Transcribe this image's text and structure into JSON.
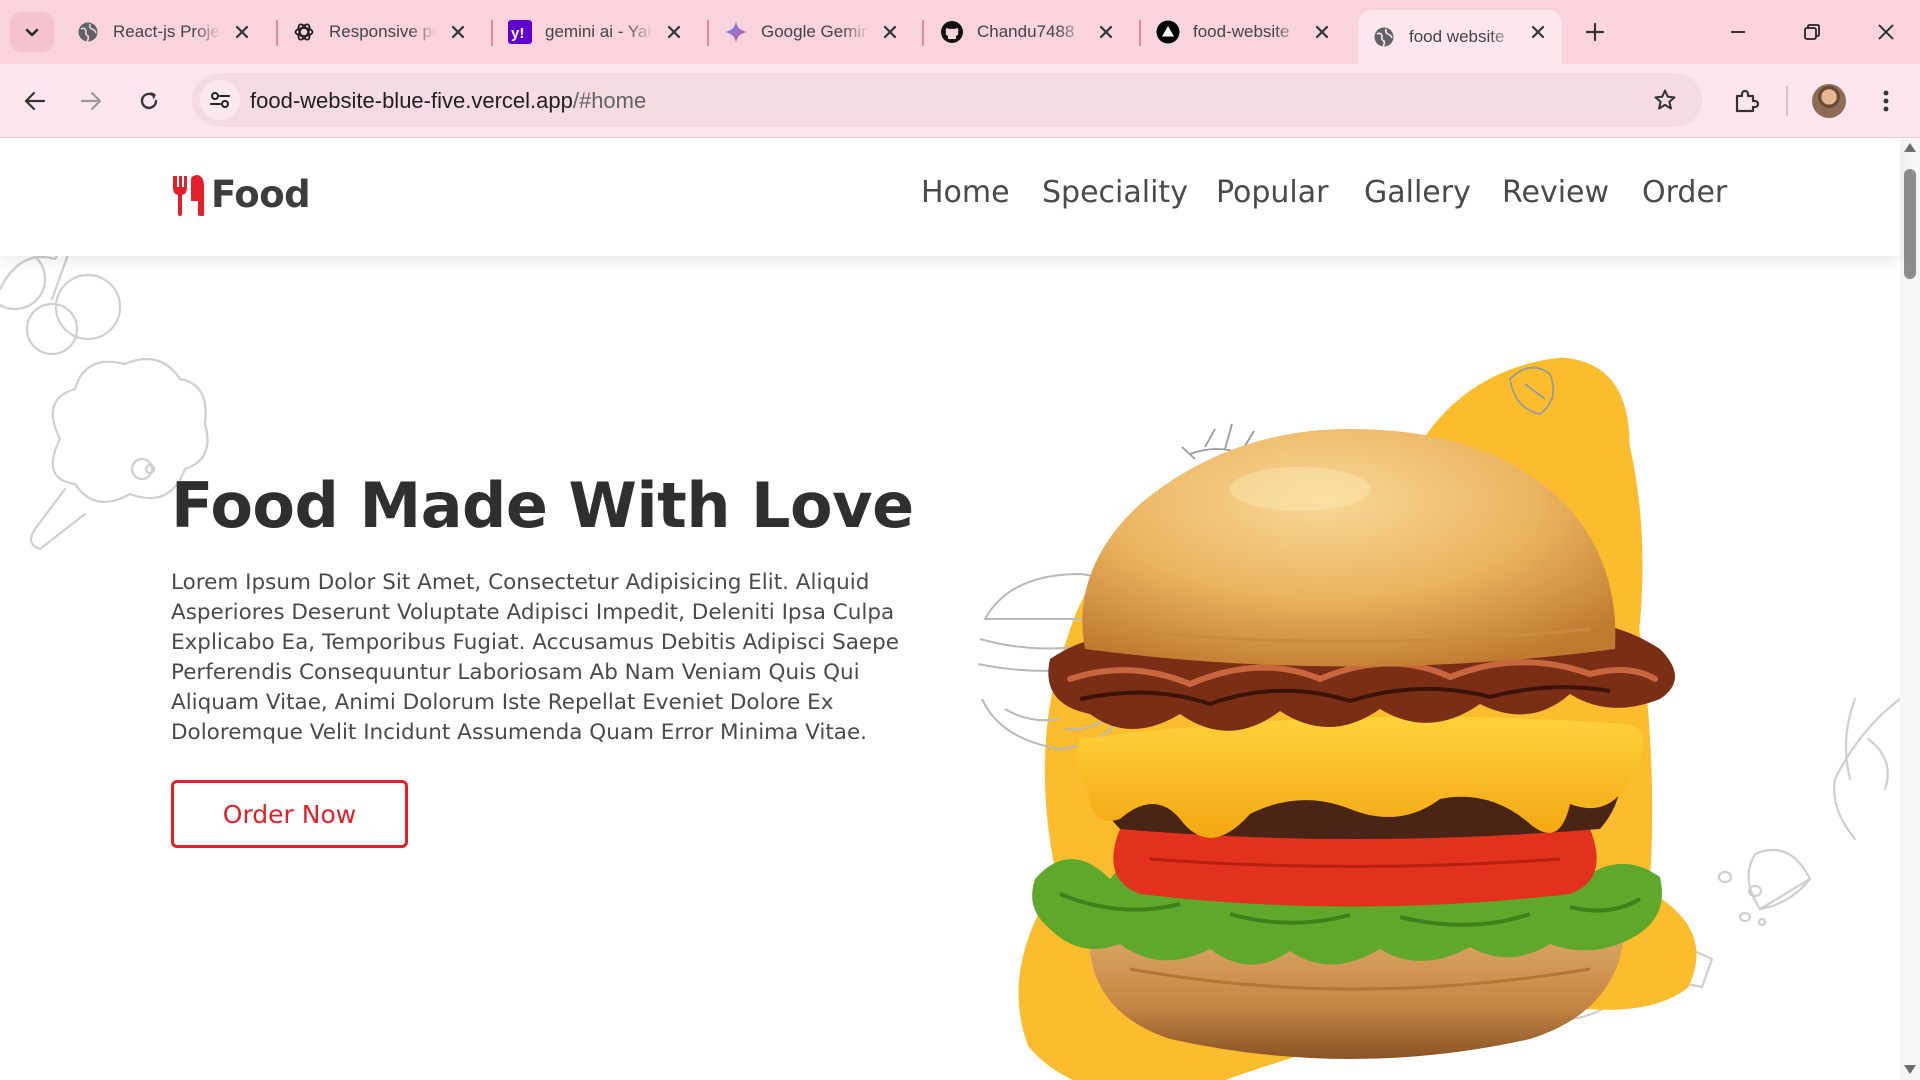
{
  "browser": {
    "tabs": [
      {
        "title": "React-js Projects",
        "icon": "globe-icon",
        "active": false
      },
      {
        "title": "Responsive portfolio",
        "icon": "openai-icon",
        "active": false
      },
      {
        "title": "gemini ai - Yahoo",
        "icon": "yahoo-icon",
        "active": false
      },
      {
        "title": "Google Gemini",
        "icon": "gemini-icon",
        "active": false
      },
      {
        "title": "Chandu7488",
        "icon": "github-icon",
        "active": false
      },
      {
        "title": "food-website",
        "icon": "vercel-icon",
        "active": false
      },
      {
        "title": "food website",
        "icon": "globe-icon",
        "active": true
      }
    ],
    "url_host": "food-website-blue-five.vercel.app",
    "url_path": "/#home",
    "colors": {
      "tabbar": "#f9d4dc",
      "toolbar": "#fde7ec",
      "omnibox": "#f6dbe2"
    }
  },
  "site": {
    "logo_text": "Food",
    "nav": [
      "Home",
      "Speciality",
      "Popular",
      "Gallery",
      "Review",
      "Order"
    ],
    "hero": {
      "title": "Food Made With Love",
      "text": "Lorem Ipsum Dolor Sit Amet, Consectetur Adipisicing Elit. Aliquid Asperiores Deserunt Voluptate Adipisci Impedit, Deleniti Ipsa Culpa Explicabo Ea, Temporibus Fugiat. Accusamus Debitis Adipisci Saepe Perferendis Consequuntur Laboriosam Ab Nam Veniam Quis Qui Aliquam Vitae, Animi Dolorum Iste Repellat Eveniet Dolore Ex Doloremque Velit Incidunt Assumenda Quam Error Minima Vitae.",
      "button": "Order Now",
      "image": "burger-with-bacon-cheese-tomato-lettuce"
    },
    "colors": {
      "accent": "#e3202a",
      "blob": "#fbbd2e",
      "text": "#2f2f2f"
    }
  }
}
